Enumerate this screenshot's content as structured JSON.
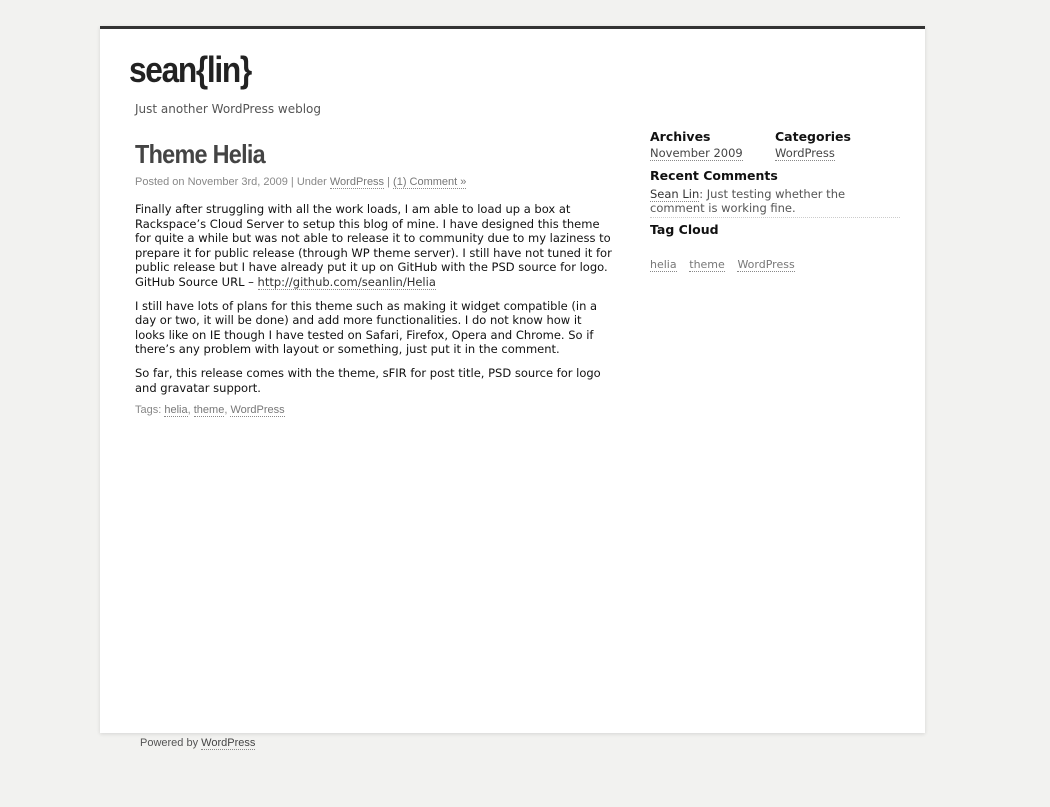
{
  "site": {
    "title": "sean{lin}",
    "tagline": "Just another WordPress weblog"
  },
  "post": {
    "title": "Theme Helia",
    "meta": {
      "posted_prefix": "Posted on November 3rd, 2009 | Under ",
      "category": "WordPress",
      "separator": " | ",
      "comments": "(1) Comment »"
    },
    "paragraphs": [
      {
        "text": "Finally after struggling with all the work loads, I am able to load up a box at Rackspace’s Cloud Server to setup this blog of mine. I have designed this theme for quite a while but was not able to release it to community due to my laziness to prepare it for public release (through WP theme server). I still have not tuned it for public release but I have already put it up on GitHub with the PSD source for logo.  GitHub Source URL – ",
        "link": "http://github.com/seanlin/Helia"
      },
      {
        "text": "I still have lots of plans for this theme such as making it widget compatible (in a day or two, it will be done) and add more functionalities. I do not know how it looks like on IE though I have tested on Safari, Firefox, Opera and Chrome. So if there’s any problem with layout or something, just put it in the comment."
      },
      {
        "text": "So far, this release comes with the theme, sFIR for post title, PSD source for logo and gravatar support."
      }
    ],
    "tags_label": "Tags: ",
    "tags": [
      "helia",
      "theme",
      "WordPress"
    ],
    "tag_separator": ", "
  },
  "sidebar": {
    "archives": {
      "heading": "Archives",
      "items": [
        "November 2009"
      ]
    },
    "categories": {
      "heading": "Categories",
      "items": [
        "WordPress"
      ]
    },
    "recent_comments": {
      "heading": "Recent Comments",
      "author": "Sean Lin",
      "text": ": Just testing whether the comment is working fine."
    },
    "tag_cloud": {
      "heading": "Tag Cloud",
      "tags": [
        "helia",
        "theme",
        "WordPress"
      ]
    }
  },
  "footer": {
    "prefix": "Powered by ",
    "link": "WordPress"
  }
}
